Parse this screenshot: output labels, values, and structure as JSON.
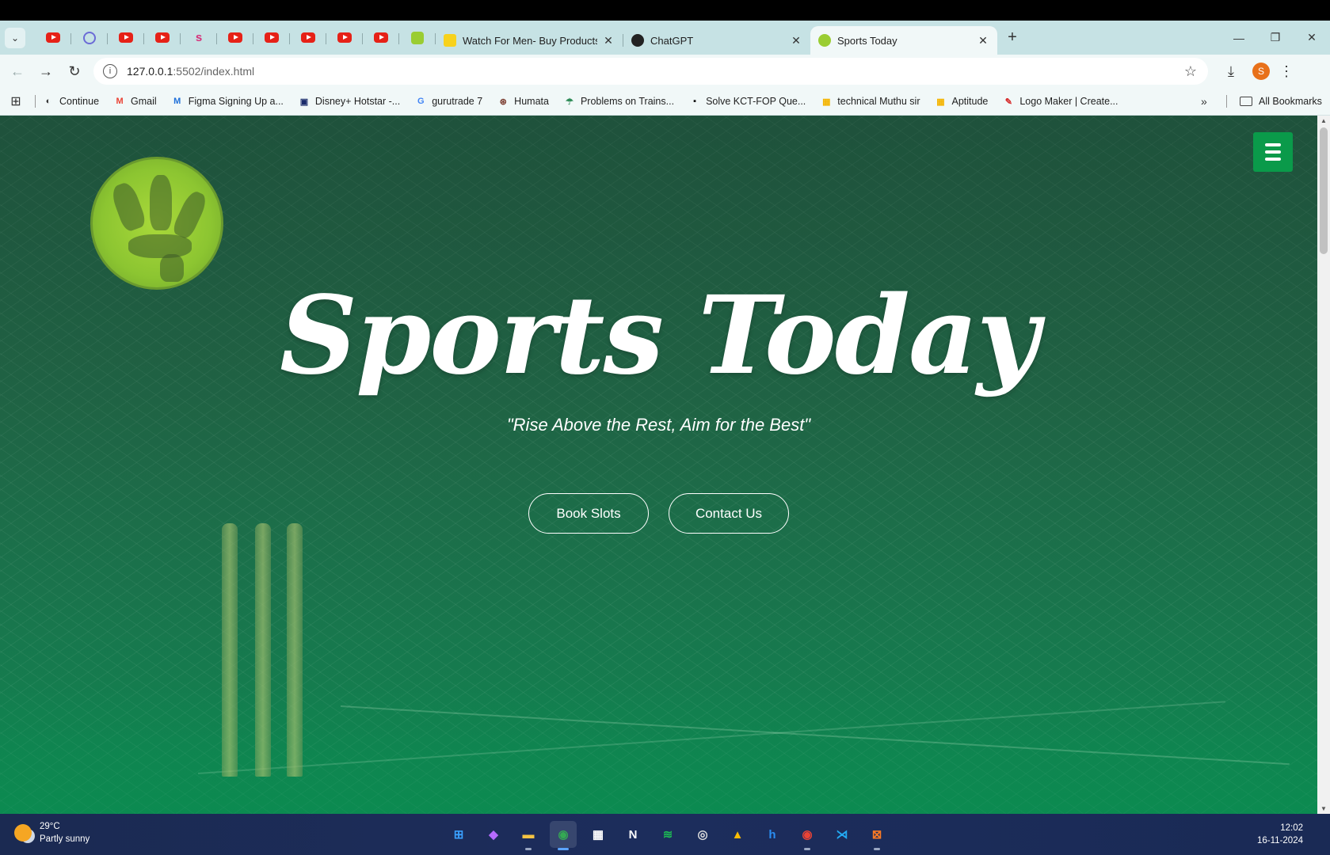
{
  "browser": {
    "tabs": [
      {
        "title": "Watch For Men- Buy Products O",
        "close": "✕"
      },
      {
        "title": "ChatGPT",
        "close": "✕"
      },
      {
        "title": "Sports Today",
        "close": "✕"
      }
    ],
    "new_tab": "+",
    "window_controls": {
      "minimize": "—",
      "restore": "❐",
      "close": "✕"
    },
    "url_host": "127.0.0.1",
    "url_rest": ":5502/index.html",
    "profile_initial": "S"
  },
  "bookmarks": [
    {
      "label": "Continue",
      "icon": "globe-icon",
      "color": "#333333",
      "glyph": "◐"
    },
    {
      "label": "Gmail",
      "icon": "gmail-icon",
      "color": "#ea4335",
      "glyph": "M"
    },
    {
      "label": "Figma Signing Up a...",
      "icon": "figma-icon",
      "color": "#1e6fd9",
      "glyph": "M"
    },
    {
      "label": "Disney+ Hotstar -...",
      "icon": "hotstar-icon",
      "color": "#1a2b6b",
      "glyph": "▣"
    },
    {
      "label": "gurutrade 7",
      "icon": "google-icon",
      "color": "#4285f4",
      "glyph": "G"
    },
    {
      "label": "Humata",
      "icon": "humata-icon",
      "color": "#7a3b2e",
      "glyph": "⊛"
    },
    {
      "label": "Problems on Trains...",
      "icon": "leaf-icon",
      "color": "#2e8b57",
      "glyph": "☂"
    },
    {
      "label": "Solve KCT-FOP Que...",
      "icon": "hackerrank-icon",
      "color": "#111111",
      "glyph": "▪"
    },
    {
      "label": "technical Muthu sir",
      "icon": "classroom-icon",
      "color": "#f4b400",
      "glyph": "▦"
    },
    {
      "label": "Aptitude",
      "icon": "classroom-icon",
      "color": "#f4b400",
      "glyph": "▦"
    },
    {
      "label": "Logo Maker | Create...",
      "icon": "brush-icon",
      "color": "#d62b2b",
      "glyph": "✎"
    }
  ],
  "bookmarks_more": "»",
  "all_bookmarks": "All Bookmarks",
  "hero": {
    "title": "Sports Today",
    "tagline": "\"Rise Above the Rest, Aim for the Best\"",
    "btn_book": "Book Slots",
    "btn_contact": "Contact Us"
  },
  "taskbar": {
    "temp": "29°C",
    "weather": "Partly sunny",
    "time": "12:02",
    "date": "16-11-2024",
    "apps": [
      {
        "name": "windows-start-icon",
        "glyph": "⊞",
        "color": "#3aa0ff",
        "active": false
      },
      {
        "name": "copilot-icon",
        "glyph": "◆",
        "color": "#b56bff",
        "active": false
      },
      {
        "name": "file-explorer-icon",
        "glyph": "▬",
        "color": "#f6c343",
        "active": false
      },
      {
        "name": "chrome-icon",
        "glyph": "◉",
        "color": "#34a853",
        "active": true
      },
      {
        "name": "store-icon",
        "glyph": "▦",
        "color": "#ffffff",
        "active": false
      },
      {
        "name": "notion-icon",
        "glyph": "N",
        "color": "#ffffff",
        "active": false
      },
      {
        "name": "spotify-icon",
        "glyph": "≋",
        "color": "#1db954",
        "active": false
      },
      {
        "name": "obs-icon",
        "glyph": "◎",
        "color": "#dddddd",
        "active": false
      },
      {
        "name": "drive-icon",
        "glyph": "▲",
        "color": "#fbbc04",
        "active": false
      },
      {
        "name": "hackerrank-app-icon",
        "glyph": "h",
        "color": "#2a8df2",
        "active": false
      },
      {
        "name": "chrome-profile-icon",
        "glyph": "◉",
        "color": "#ea4335",
        "active": false
      },
      {
        "name": "vscode-icon",
        "glyph": "⋊",
        "color": "#23a9f2",
        "active": false
      },
      {
        "name": "xampp-icon",
        "glyph": "⊠",
        "color": "#fb7a24",
        "active": false
      }
    ]
  }
}
